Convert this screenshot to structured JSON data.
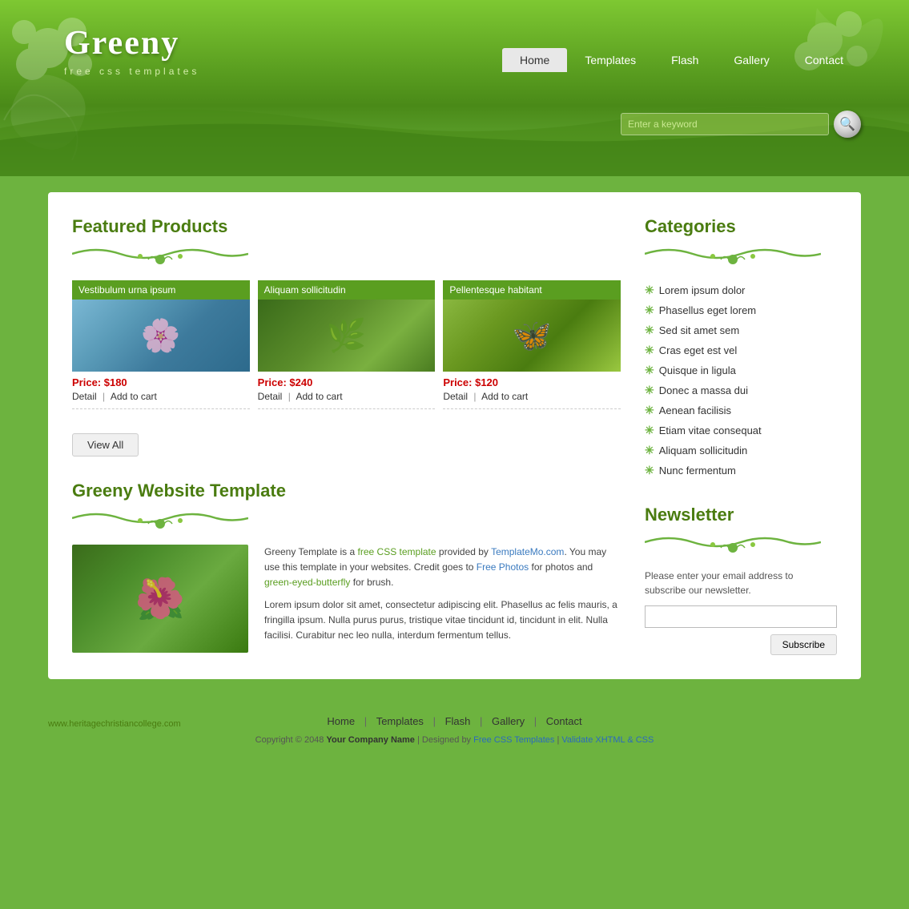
{
  "site": {
    "title": "Greeny",
    "subtitle": "free css templates",
    "url": "www.heritagechristiancollege.com"
  },
  "nav": {
    "items": [
      {
        "label": "Home",
        "active": true
      },
      {
        "label": "Templates",
        "active": false
      },
      {
        "label": "Flash",
        "active": false
      },
      {
        "label": "Gallery",
        "active": false
      },
      {
        "label": "Contact",
        "active": false
      }
    ]
  },
  "search": {
    "placeholder": "Enter a keyword"
  },
  "featured": {
    "title": "Featured Products",
    "products": [
      {
        "label": "Vestibulum urna ipsum",
        "price": "Price: $180",
        "detail": "Detail",
        "add_to_cart": "Add to cart"
      },
      {
        "label": "Aliquam sollicitudin",
        "price": "Price: $240",
        "detail": "Detail",
        "add_to_cart": "Add to cart"
      },
      {
        "label": "Pellentesque habitant",
        "price": "Price: $120",
        "detail": "Detail",
        "add_to_cart": "Add to cart"
      }
    ],
    "view_all": "View All"
  },
  "about": {
    "title": "Greeny Website Template",
    "text1": "Greeny Template is a free CSS template provided by TemplateMo.com. You may use this template in your websites. Credit goes to Free Photos for photos and green-eyed-butterfly for brush.",
    "text2": "Lorem ipsum dolor sit amet, consectetur adipiscing elit. Phasellus ac felis mauris, a fringilla ipsum. Nulla purus purus, tristique vitae tincidunt id, tincidunt in elit. Nulla facilisi. Curabitur nec leo nulla, interdum fermentum tellus.",
    "links": {
      "free_css": "free CSS template",
      "templatemo": "TemplateMo.com",
      "free_photos": "Free Photos",
      "butterfly": "green-eyed-butterfly"
    }
  },
  "categories": {
    "title": "Categories",
    "items": [
      "Lorem ipsum dolor",
      "Phasellus eget lorem",
      "Sed sit amet sem",
      "Cras eget est vel",
      "Quisque in ligula",
      "Donec a massa dui",
      "Aenean facilisis",
      "Etiam vitae consequat",
      "Aliquam sollicitudin",
      "Nunc fermentum"
    ]
  },
  "newsletter": {
    "title": "Newsletter",
    "description": "Please enter your email address to subscribe our newsletter.",
    "subscribe_label": "Subscribe"
  },
  "footer": {
    "nav_items": [
      "Home",
      "Templates",
      "Flash",
      "Gallery",
      "Contact"
    ],
    "copyright": "Copyright © 2048",
    "company": "Your Company Name",
    "designed_by": "Designed by",
    "css_templates": "Free CSS Templates",
    "validate": "Validate XHTML & CSS"
  },
  "colors": {
    "green_dark": "#4a7c10",
    "green_mid": "#6db33f",
    "green_header": "#7ec832",
    "red_price": "#cc0000"
  }
}
